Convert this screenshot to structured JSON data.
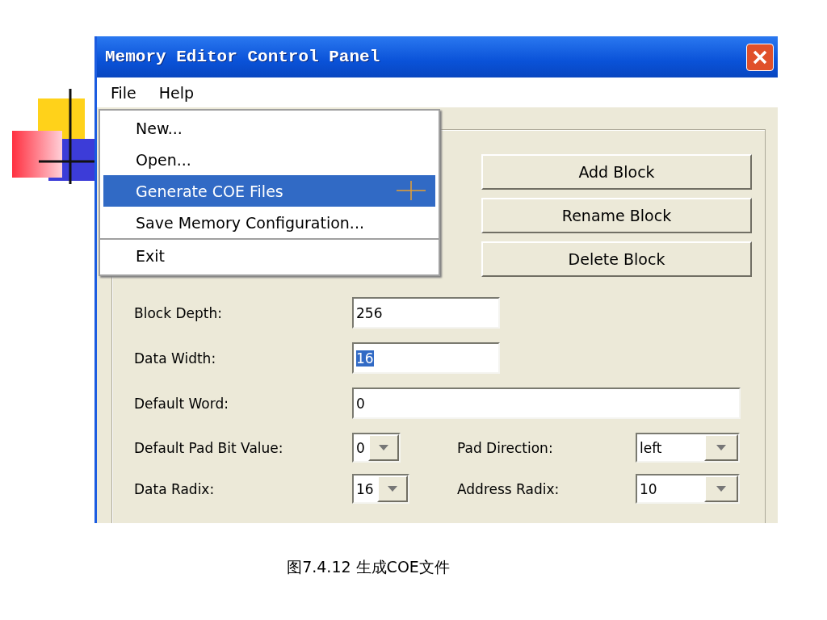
{
  "window": {
    "title": "Memory Editor Control Panel"
  },
  "menu_bar": [
    "File",
    "Help"
  ],
  "file_menu": [
    {
      "label": "New...",
      "selected": false,
      "separator_before": false
    },
    {
      "label": "Open...",
      "selected": false,
      "separator_before": false
    },
    {
      "label": "Generate COE Files",
      "selected": true,
      "separator_before": false
    },
    {
      "label": "Save Memory Configuration...",
      "selected": false,
      "separator_before": false
    },
    {
      "label": "Exit",
      "selected": false,
      "separator_before": true
    }
  ],
  "buttons": [
    "Add Block",
    "Rename Block",
    "Delete Block"
  ],
  "text_fields": [
    {
      "label": "Block Depth:",
      "value": "256",
      "wide": false,
      "selected": false
    },
    {
      "label": "Data Width:",
      "value": "16",
      "wide": false,
      "selected": true
    },
    {
      "label": "Default Word:",
      "value": "0",
      "wide": true,
      "selected": false
    }
  ],
  "combo_rows": [
    [
      {
        "label": "Default Pad Bit Value:",
        "value": "0"
      },
      {
        "label": "Pad Direction:",
        "value": "left"
      }
    ],
    [
      {
        "label": "Data Radix:",
        "value": "16"
      },
      {
        "label": "Address Radix:",
        "value": "10"
      }
    ]
  ],
  "caption": "图7.4.12 生成COE文件"
}
